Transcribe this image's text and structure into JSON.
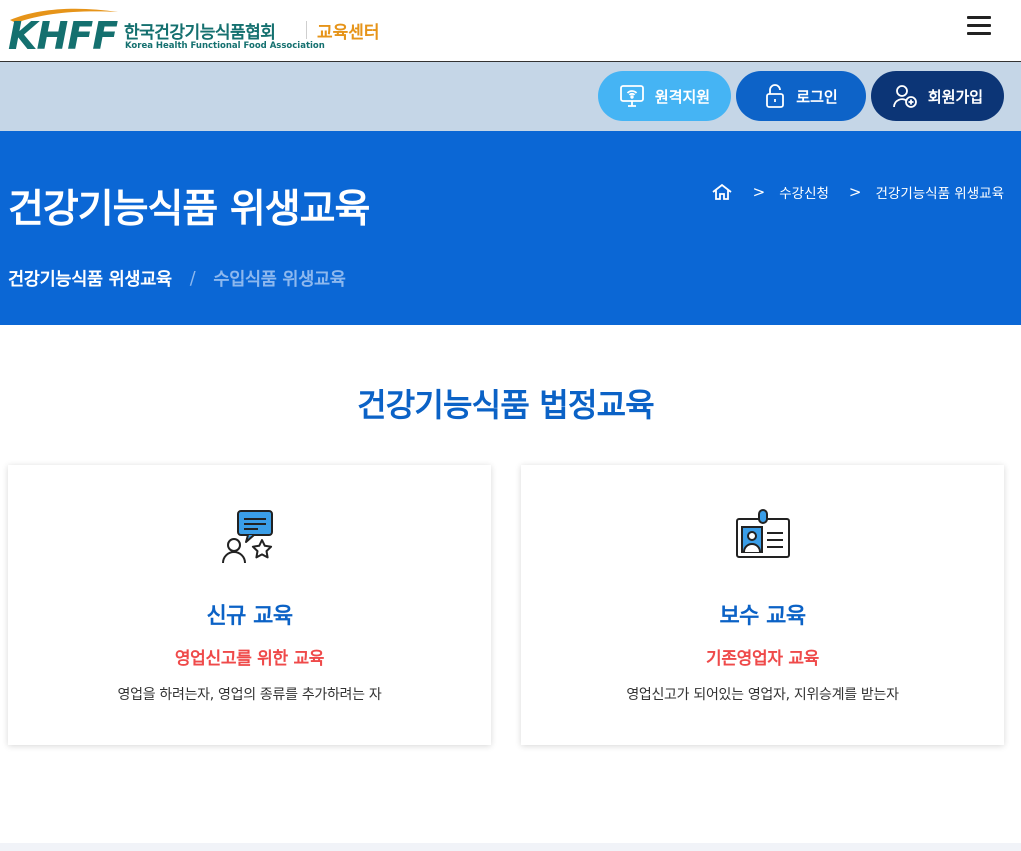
{
  "header": {
    "logo_mark": "KHFF",
    "logo_name_ko": "한국건강기능식품협회",
    "logo_name_en": "Korea Health Functional Food Association",
    "logo_center": "교육센터",
    "menu_icon": "hamburger-menu-icon"
  },
  "utility": {
    "remote_label": "원격지원",
    "login_label": "로그인",
    "join_label": "회원가입",
    "icons": [
      "monitor-wifi-icon",
      "lock-icon",
      "user-plus-icon"
    ]
  },
  "hero": {
    "title": "건강기능식품 위생교육",
    "breadcrumb": [
      "수강신청",
      "건강기능식품 위생교육"
    ],
    "subnav_active": "건강기능식품 위생교육",
    "subnav_separator": "/",
    "subnav_inactive": "수입식품 위생교육"
  },
  "section": {
    "title": "건강기능식품 법정교육"
  },
  "cards": [
    {
      "icon": "user-chat-star-icon",
      "title": "신규 교육",
      "subtitle": "영업신고를 위한 교육",
      "description": "영업을 하려는자, 영업의 종류를 추가하려는 자"
    },
    {
      "icon": "id-badge-icon",
      "title": "보수 교육",
      "subtitle": "기존영업자 교육",
      "description": "영업신고가 되어있는 영업자, 지위승계를 받는자"
    }
  ],
  "colors": {
    "hero_bg": "#0b67d5",
    "util_bg": "#c5d6e7",
    "accent_blue": "#0b62c6",
    "accent_red": "#ef4a4a",
    "brand_teal": "#14706f",
    "brand_orange": "#e69419"
  }
}
